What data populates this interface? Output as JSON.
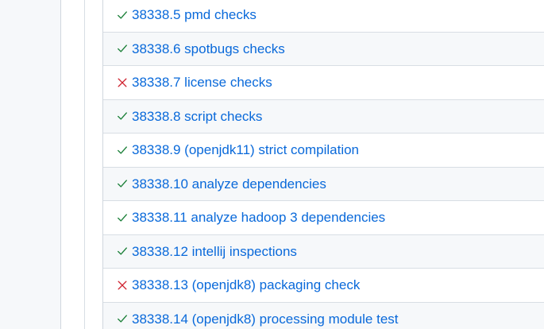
{
  "checks": [
    {
      "label": "38338.5 pmd checks",
      "status": "success",
      "icon": "check-icon"
    },
    {
      "label": "38338.6 spotbugs checks",
      "status": "success",
      "icon": "check-icon"
    },
    {
      "label": "38338.7 license checks",
      "status": "failure",
      "icon": "x-icon"
    },
    {
      "label": "38338.8 script checks",
      "status": "success",
      "icon": "check-icon"
    },
    {
      "label": "38338.9 (openjdk11) strict compilation",
      "status": "success",
      "icon": "check-icon"
    },
    {
      "label": "38338.10 analyze dependencies",
      "status": "success",
      "icon": "check-icon"
    },
    {
      "label": "38338.11 analyze hadoop 3 dependencies",
      "status": "success",
      "icon": "check-icon"
    },
    {
      "label": "38338.12 intellij inspections",
      "status": "success",
      "icon": "check-icon"
    },
    {
      "label": "38338.13 (openjdk8) packaging check",
      "status": "failure",
      "icon": "x-icon"
    },
    {
      "label": "38338.14 (openjdk8) processing module test",
      "status": "success",
      "icon": "check-icon"
    }
  ],
  "colors": {
    "success": "#1a7f37",
    "failure": "#cf222e",
    "link": "#0969da"
  }
}
